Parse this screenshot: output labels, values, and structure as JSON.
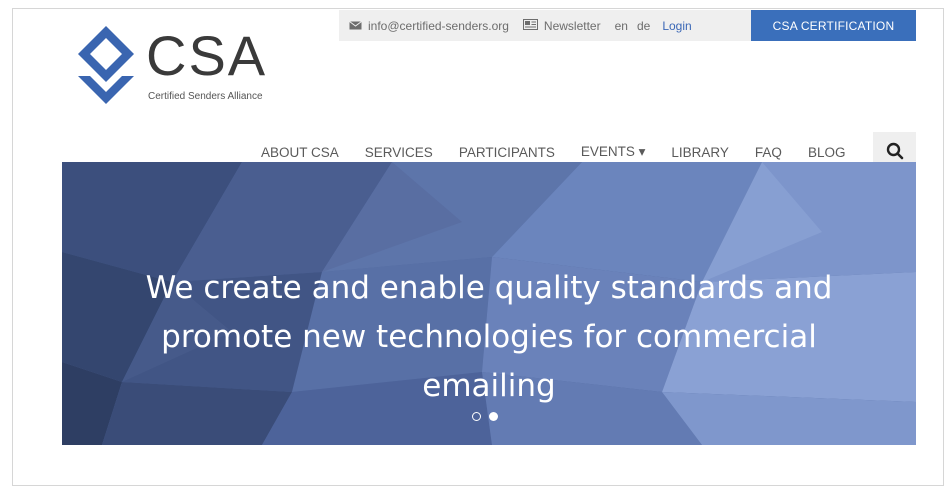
{
  "topbar": {
    "email": "info@certified-senders.org",
    "newsletter": "Newsletter",
    "languages": [
      "en",
      "de"
    ],
    "login": "Login",
    "cta": "CSA CERTIFICATION"
  },
  "logo": {
    "mark": "CSA",
    "subtitle": "Certified Senders Alliance"
  },
  "nav": {
    "items": [
      {
        "label": "ABOUT CSA"
      },
      {
        "label": "SERVICES"
      },
      {
        "label": "PARTICIPANTS"
      },
      {
        "label": "EVENTS ▾"
      },
      {
        "label": "LIBRARY"
      },
      {
        "label": "FAQ"
      },
      {
        "label": "BLOG"
      }
    ]
  },
  "hero": {
    "headline": "We create and enable quality standards and promote new technologies for commercial emailing",
    "slides": 2,
    "active_slide": 2
  },
  "colors": {
    "accent": "#3a6fbb",
    "hero_bg": "#4f6397",
    "logo_blue": "#3a65b0"
  }
}
